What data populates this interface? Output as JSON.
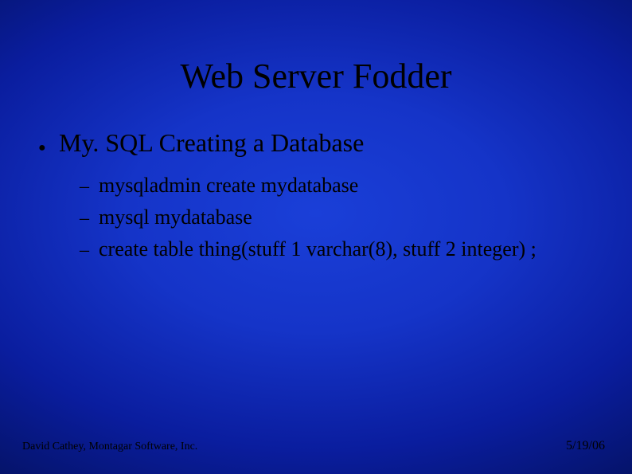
{
  "title": "Web Server Fodder",
  "heading": "My. SQL Creating a Database",
  "subitems": [
    "mysqladmin create mydatabase",
    "mysql mydatabase",
    "create table thing(stuff 1 varchar(8), stuff 2 integer) ;"
  ],
  "footer": {
    "author": "David Cathey, Montagar Software, Inc.",
    "date": "5/19/06"
  }
}
